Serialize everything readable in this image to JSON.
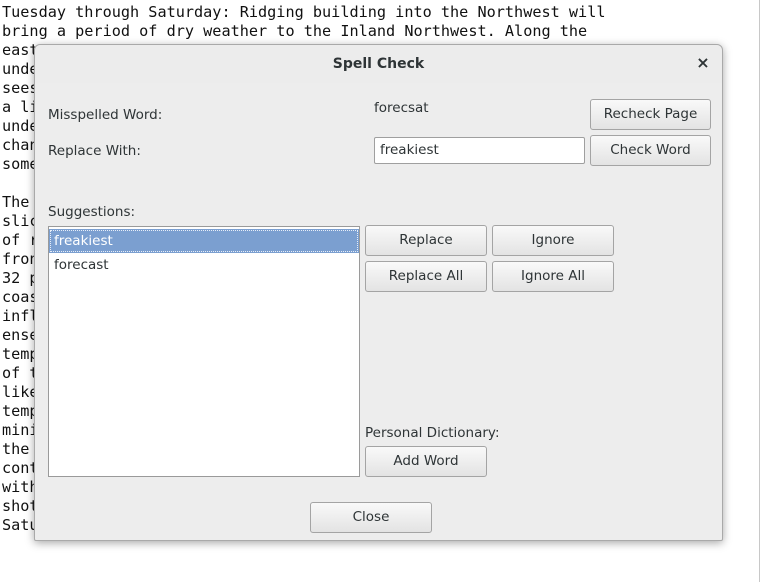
{
  "document": {
    "lines": [
      "Tuesday through Saturday: Ridging building into the Northwest will",
      "bring a period of dry weather to the Inland Northwest. Along the",
      "east",
      "unde",
      "sees",
      "a li",
      "unde",
      "chan",
      "some",
      "",
      "The",
      "slic",
      "of r",
      "fron",
      "32 p",
      "coas",
      "infl",
      "ense",
      "temp",
      "of t",
      "like",
      "temp",
      "mini",
      "the",
      "cont",
      "with",
      "shot",
      "Satu"
    ]
  },
  "dialog": {
    "title": "Spell Check",
    "close_glyph": "×",
    "misspelled_label": "Misspelled Word:",
    "misspelled_word": "forecsat",
    "replace_with_label": "Replace With:",
    "replace_with_value": "freakiest",
    "suggestions_label": "Suggestions:",
    "suggestions": [
      "freakiest",
      "forecast"
    ],
    "selected_suggestion": 0,
    "buttons": {
      "recheck_page": "Recheck Page",
      "check_word": "Check Word",
      "replace": "Replace",
      "ignore": "Ignore",
      "replace_all": "Replace All",
      "ignore_all": "Ignore All",
      "add_word": "Add Word",
      "close": "Close"
    },
    "personal_dictionary_label": "Personal Dictionary:"
  },
  "colors": {
    "selection": "#7b9fd0",
    "dialog_bg": "#ededed"
  }
}
